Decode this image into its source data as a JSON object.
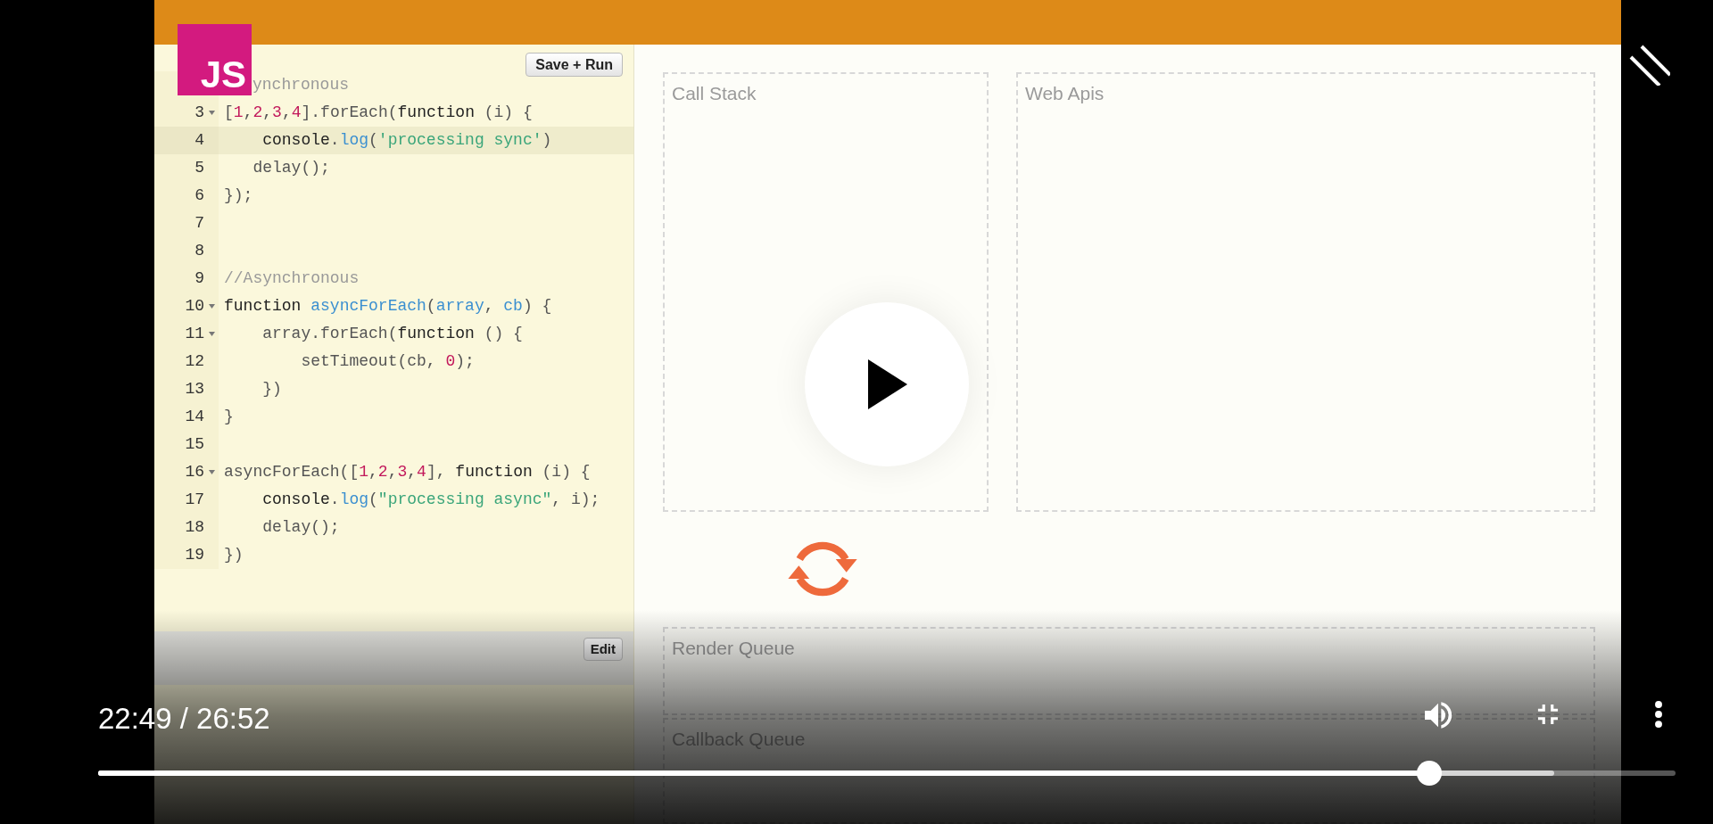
{
  "channel_badge": {
    "text": "JS"
  },
  "editor": {
    "save_button": "Save + Run",
    "edit_button": "Edit",
    "lines": [
      {
        "active": false,
        "tokens": [
          {
            "text": "ynchronous",
            "kind": "comment"
          }
        ]
      },
      {
        "number": "3",
        "foldable": true,
        "active": false,
        "tokens": [
          {
            "text": "[",
            "kind": "plain"
          },
          {
            "text": "1",
            "kind": "number"
          },
          {
            "text": ",",
            "kind": "plain"
          },
          {
            "text": "2",
            "kind": "number"
          },
          {
            "text": ",",
            "kind": "plain"
          },
          {
            "text": "3",
            "kind": "number"
          },
          {
            "text": ",",
            "kind": "plain"
          },
          {
            "text": "4",
            "kind": "number"
          },
          {
            "text": "].forEach(",
            "kind": "plain"
          },
          {
            "text": "function",
            "kind": "keyword"
          },
          {
            "text": " (i) {",
            "kind": "plain"
          }
        ]
      },
      {
        "number": "4",
        "foldable": false,
        "active": true,
        "tokens": [
          {
            "text": "    console",
            "kind": "keyword"
          },
          {
            "text": ".",
            "kind": "plain"
          },
          {
            "text": "log",
            "kind": "method"
          },
          {
            "text": "(",
            "kind": "plain"
          },
          {
            "text": "'processing sync'",
            "kind": "string"
          },
          {
            "text": ")",
            "kind": "plain"
          }
        ]
      },
      {
        "number": "5",
        "foldable": false,
        "active": false,
        "tokens": [
          {
            "text": "   delay();",
            "kind": "plain"
          }
        ]
      },
      {
        "number": "6",
        "foldable": false,
        "active": false,
        "tokens": [
          {
            "text": "});",
            "kind": "plain"
          }
        ]
      },
      {
        "number": "7",
        "foldable": false,
        "active": false
      },
      {
        "number": "8",
        "foldable": false,
        "active": false
      },
      {
        "number": "9",
        "foldable": false,
        "active": false,
        "tokens": [
          {
            "text": "//Asynchronous",
            "kind": "comment"
          }
        ]
      },
      {
        "number": "10",
        "foldable": true,
        "active": false,
        "tokens": [
          {
            "text": "function",
            "kind": "keyword"
          },
          {
            "text": " asyncForEach",
            "kind": "method"
          },
          {
            "text": "(",
            "kind": "plain"
          },
          {
            "text": "array",
            "kind": "method"
          },
          {
            "text": ", ",
            "kind": "plain"
          },
          {
            "text": "cb",
            "kind": "method"
          },
          {
            "text": ") {",
            "kind": "plain"
          }
        ]
      },
      {
        "number": "11",
        "foldable": true,
        "active": false,
        "tokens": [
          {
            "text": "    array.forEach(",
            "kind": "plain"
          },
          {
            "text": "function",
            "kind": "keyword"
          },
          {
            "text": " () {",
            "kind": "plain"
          }
        ]
      },
      {
        "number": "12",
        "foldable": false,
        "active": false,
        "tokens": [
          {
            "text": "        setTimeout(cb, ",
            "kind": "plain"
          },
          {
            "text": "0",
            "kind": "number"
          },
          {
            "text": ");",
            "kind": "plain"
          }
        ]
      },
      {
        "number": "13",
        "foldable": false,
        "active": false,
        "tokens": [
          {
            "text": "    })",
            "kind": "plain"
          }
        ]
      },
      {
        "number": "14",
        "foldable": false,
        "active": false,
        "tokens": [
          {
            "text": "}",
            "kind": "plain"
          }
        ]
      },
      {
        "number": "15",
        "foldable": false,
        "active": false
      },
      {
        "number": "16",
        "foldable": true,
        "active": false,
        "tokens": [
          {
            "text": "asyncForEach([",
            "kind": "plain"
          },
          {
            "text": "1",
            "kind": "number"
          },
          {
            "text": ",",
            "kind": "plain"
          },
          {
            "text": "2",
            "kind": "number"
          },
          {
            "text": ",",
            "kind": "plain"
          },
          {
            "text": "3",
            "kind": "number"
          },
          {
            "text": ",",
            "kind": "plain"
          },
          {
            "text": "4",
            "kind": "number"
          },
          {
            "text": "], ",
            "kind": "plain"
          },
          {
            "text": "function",
            "kind": "keyword"
          },
          {
            "text": " (i) {",
            "kind": "plain"
          }
        ]
      },
      {
        "number": "17",
        "foldable": false,
        "active": false,
        "tokens": [
          {
            "text": "    console",
            "kind": "keyword"
          },
          {
            "text": ".",
            "kind": "plain"
          },
          {
            "text": "log",
            "kind": "method"
          },
          {
            "text": "(",
            "kind": "plain"
          },
          {
            "text": "\"processing async\"",
            "kind": "string"
          },
          {
            "text": ", i);",
            "kind": "plain"
          }
        ]
      },
      {
        "number": "18",
        "foldable": false,
        "active": false,
        "tokens": [
          {
            "text": "    delay();",
            "kind": "plain"
          }
        ]
      },
      {
        "number": "19",
        "foldable": false,
        "active": false,
        "tokens": [
          {
            "text": "})",
            "kind": "plain"
          }
        ]
      }
    ]
  },
  "panels": {
    "call_stack": "Call Stack",
    "web_apis": "Web Apis",
    "render_queue": "Render Queue",
    "callback_queue": "Callback Queue"
  },
  "player": {
    "time": "22:49 / 26:52",
    "progress": {
      "level": 0.844
    },
    "buffer": {
      "level": 0.923
    }
  }
}
